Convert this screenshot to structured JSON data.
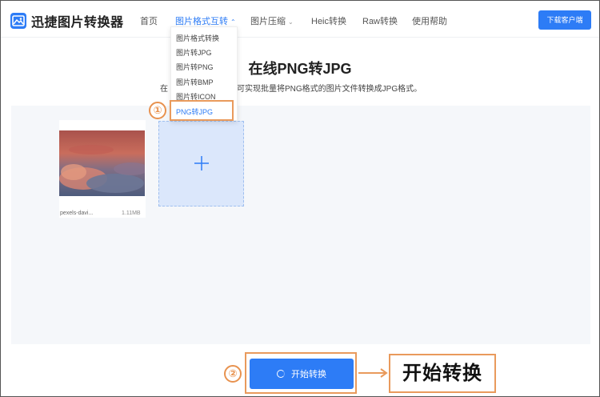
{
  "header": {
    "app_title": "迅捷图片转换器",
    "nav": [
      {
        "label": "首页",
        "active": false,
        "chevron": false
      },
      {
        "label": "图片格式互转",
        "active": true,
        "chevron": true
      },
      {
        "label": "图片压缩",
        "active": false,
        "chevron": true
      },
      {
        "label": "Heic转换",
        "active": false,
        "chevron": false
      },
      {
        "label": "Raw转换",
        "active": false,
        "chevron": false
      },
      {
        "label": "使用帮助",
        "active": false,
        "chevron": false
      }
    ],
    "download_button": "下载客户端"
  },
  "dropdown": {
    "items": [
      {
        "label": "图片格式转换",
        "selected": false
      },
      {
        "label": "图片转JPG",
        "selected": false
      },
      {
        "label": "图片转PNG",
        "selected": false
      },
      {
        "label": "图片转BMP",
        "selected": false
      },
      {
        "label": "图片转ICON",
        "selected": false
      },
      {
        "label": "PNG转JPG",
        "selected": true
      }
    ]
  },
  "main": {
    "title": "在线PNG转JPG",
    "subtitle_start": "在",
    "subtitle_rest": "，可实现批量将PNG格式的图片文件转换成JPG格式。"
  },
  "upload": {
    "file_name": "pexels-davi...",
    "file_size": "1.11MB"
  },
  "actions": {
    "start_button": "开始转换"
  },
  "annotations": {
    "step1": "①",
    "step2": "②",
    "callout": "开始转换",
    "accent_color": "#e99a5c"
  },
  "colors": {
    "brand": "#2d7cf6",
    "upload_bg": "#f5f7fa",
    "add_box_bg": "#dbe7fb"
  }
}
